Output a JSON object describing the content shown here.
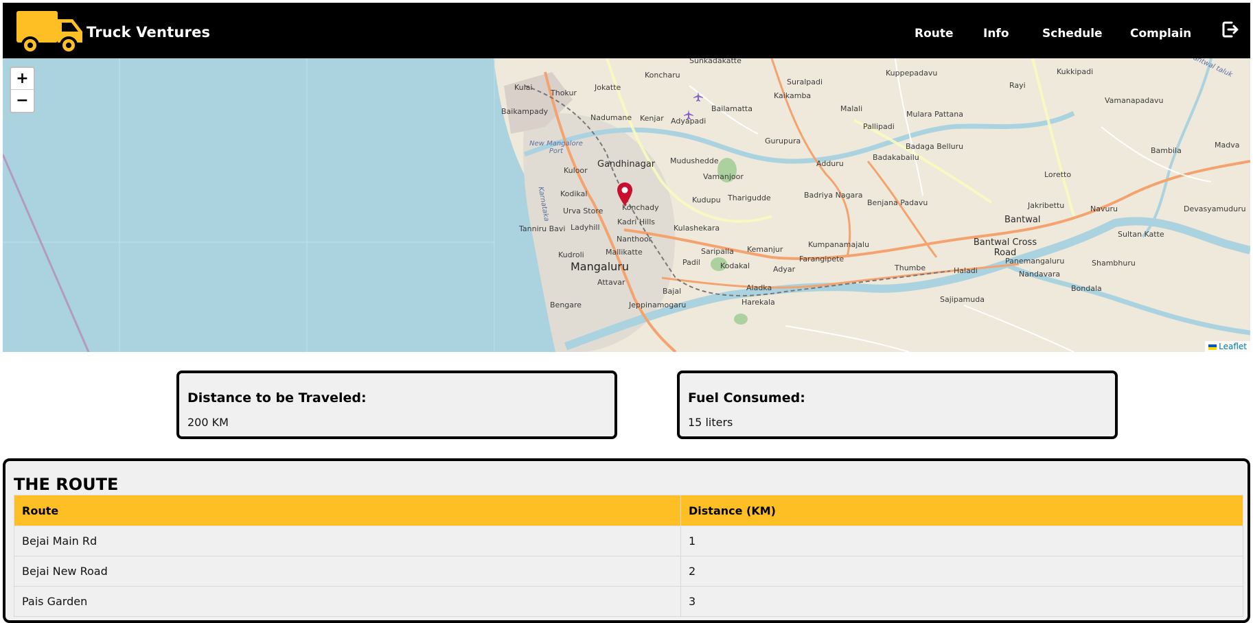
{
  "app": {
    "brand": "Truck Ventures",
    "logo_icon": "truck-icon",
    "accent_color": "#FDBF23"
  },
  "nav": {
    "items": [
      {
        "label": "Route"
      },
      {
        "label": "Info"
      },
      {
        "label": "Schedule"
      },
      {
        "label": "Complain"
      }
    ],
    "logout_icon": "logout-icon"
  },
  "map": {
    "zoom_in": "+",
    "zoom_out": "−",
    "attribution": "Leaflet",
    "marker_icon": "map-pin-icon",
    "labels": {
      "sunkadakatte": "Sunkadakatte",
      "koncharu": "Koncharu",
      "suralpadi": "Suralpadi",
      "kuppepadavu": "Kuppepadavu",
      "kukkipadi": "Kukkipadi",
      "rayi": "Rayi",
      "vamanapadavu": "Vamanapadavu",
      "bantwal_taluk": "Bantwal taluk",
      "kulai": "Kulai",
      "jokatte": "Jokatte",
      "thokur": "Thokur",
      "baikampady": "Baikampady",
      "bailamatta": "Bailamatta",
      "kaikamba": "Kaikamba",
      "malali": "Malali",
      "mulara_pattana": "Mulara Pattana",
      "nadumane": "Nadumane",
      "kenjar": "Kenjar",
      "adyapadi": "Adyapadi",
      "pallipadi": "Pallipadi",
      "gurupura": "Gurupura",
      "new_mangalore_port": "New Mangalore Port",
      "badaga_belluru": "Badaga Belluru",
      "bambila": "Bambila",
      "madva": "Madva",
      "gandhinagar": "Gandhinagar",
      "mudushedde": "Mudushedde",
      "adduru": "Adduru",
      "badakabailu": "Badakabailu",
      "loretto": "Loretto",
      "kuloor": "Kuloor",
      "vamanjoor": "Vamanjoor",
      "tharigudde": "Tharigudde",
      "badriya_nagara": "Badriya Nagara",
      "kodikal": "Kodikal",
      "konchady": "Konchady",
      "kudupu": "Kudupu",
      "benjana_padavu": "Benjana Padavu",
      "jakribettu": "Jakribettu",
      "navuru": "Navuru",
      "devasyamuduru": "Devasyamuduru",
      "urva_store": "Urva Store",
      "karnataka": "Karnataka",
      "kadri_hills": "Kadri Hills",
      "bantwal": "Bantwal",
      "tanniru_bavi": "Tanniru Bavi",
      "ladyhill": "Ladyhill",
      "kulashekara": "Kulashekara",
      "sultan_katte": "Sultan Katte",
      "nanthoor": "Nanthoor",
      "bantwal_cross_road": "Bantwal Cross Road",
      "kumpanamajalu": "Kumpanamajalu",
      "mallikatte": "Mallikatte",
      "saripalla": "Saripalla",
      "kemanjur": "Kemanjur",
      "kudroli": "Kudroli",
      "farangipete": "Farangipete",
      "panemangaluru": "Panemangaluru",
      "shambhuru": "Shambhuru",
      "padil": "Padil",
      "kodakal": "Kodakal",
      "mangaluru": "Mangaluru",
      "adyar": "Adyar",
      "thumbe": "Thumbe",
      "haladi": "Haladi",
      "nandavara": "Nandavara",
      "attavar": "Attavar",
      "bondala": "Bondala",
      "aladka": "Aladka",
      "bajal": "Bajal",
      "harekala": "Harekala",
      "sajipamuda": "Sajipamuda",
      "bengare": "Bengare",
      "jeppinamogaru": "Jeppinamogaru"
    }
  },
  "cards": {
    "distance": {
      "title": "Distance to be Traveled:",
      "value": "200 KM"
    },
    "fuel": {
      "title": "Fuel Consumed:",
      "value": "15 liters"
    }
  },
  "route": {
    "title": "THE ROUTE",
    "columns": [
      "Route",
      "Distance (KM)"
    ],
    "rows": [
      {
        "route": "Bejai Main Rd",
        "distance": "1"
      },
      {
        "route": "Bejai New Road",
        "distance": "2"
      },
      {
        "route": "Pais Garden",
        "distance": "3"
      }
    ]
  }
}
